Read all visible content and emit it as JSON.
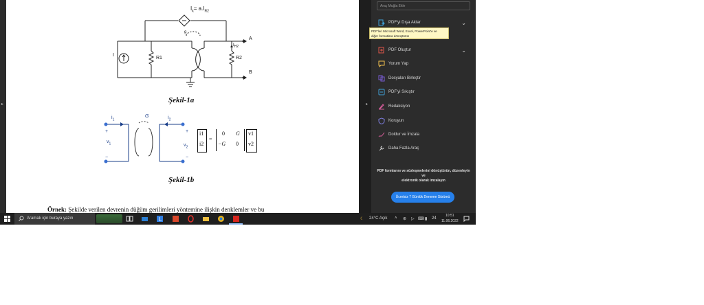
{
  "document": {
    "circuit_a": {
      "current_source_label": "I",
      "r1_label": "R1",
      "r2_label": "R2",
      "dependent_source_label": "I",
      "dependent_source_sub": "k",
      "dependent_source_expr": "= a.I",
      "dependent_source_expr_sub": "R2",
      "ih2_label": "I",
      "ih2_sub": "H2",
      "terminal_a": "A",
      "terminal_b": "B",
      "gyrator_g": "g",
      "caption": "Şekil-1a"
    },
    "circuit_b": {
      "i1": "i",
      "i1_sub": "1",
      "i2": "i",
      "i2_sub": "2",
      "g_label": "G",
      "v1": "v",
      "v1_sub": "1",
      "v2": "v",
      "v2_sub": "2",
      "plus": "+",
      "minus": "−",
      "matrix_lhs_1": "i1",
      "matrix_lhs_2": "i2",
      "matrix_eq": "=",
      "matrix_a11": "0",
      "matrix_a12": "G",
      "matrix_a21": "−G",
      "matrix_a22": "0",
      "matrix_rhs_1": "v1",
      "matrix_rhs_2": "v2",
      "caption": "Şekil-1b"
    },
    "bottom_text_bold": "Örnek:",
    "bottom_text": "Şekilde verilen devrenin düğüm gerilimleri yöntemine ilişkin denklemler ve bu"
  },
  "panel": {
    "search_placeholder": "Araç Muğla Ekle",
    "tools": [
      {
        "label": "PDF'yi Dışa Aktar",
        "icon": "export-pdf-icon",
        "color": "#3fa0d6",
        "chevron": true
      },
      {
        "label": "PDF Oluştur",
        "icon": "create-pdf-icon",
        "color": "#e0564a",
        "chevron": true
      },
      {
        "label": "Yorum Yap",
        "icon": "comment-icon",
        "color": "#f2c14e",
        "chevron": false
      },
      {
        "label": "Dosyaları Birleştir",
        "icon": "combine-files-icon",
        "color": "#7a5cd6",
        "chevron": false
      },
      {
        "label": "PDF'yi Sıkıştır",
        "icon": "compress-pdf-icon",
        "color": "#3fa0d6",
        "chevron": false
      },
      {
        "label": "Redaksiyon",
        "icon": "redact-icon",
        "color": "#d65c9a",
        "chevron": false
      },
      {
        "label": "Koruyun",
        "icon": "protect-icon",
        "color": "#7a7ad6",
        "chevron": false
      },
      {
        "label": "Doldur ve İmzala",
        "icon": "fill-sign-icon",
        "color": "#d65c9a",
        "chevron": false
      },
      {
        "label": "Daha Fazla Araç",
        "icon": "more-tools-icon",
        "color": "#cfcfcf",
        "chevron": false
      }
    ],
    "tooltip_line1": "PDF'leri Microsoft Word, Excel, PowerPoint'e ve",
    "tooltip_line2": "diğer formatlara dönüştürün",
    "promo_line1": "PDF formlarını ve sözleşmelerini dönüştürün, düzenleyin",
    "promo_line2": "ve",
    "promo_line3": "elektronik olarak imzalayın",
    "trial_button": "Ücretsiz 7 Günlük Deneme Sürümü"
  },
  "taskbar": {
    "search_text": "Aramak için buraya yazın",
    "weather": "24°C  Açık",
    "time": "10:51",
    "date": "11.06.2022",
    "notif_count": "24",
    "colors": {
      "accent": "#2680eb",
      "taskbar": "#1f1f1f",
      "panel": "#2c2c2c"
    }
  }
}
